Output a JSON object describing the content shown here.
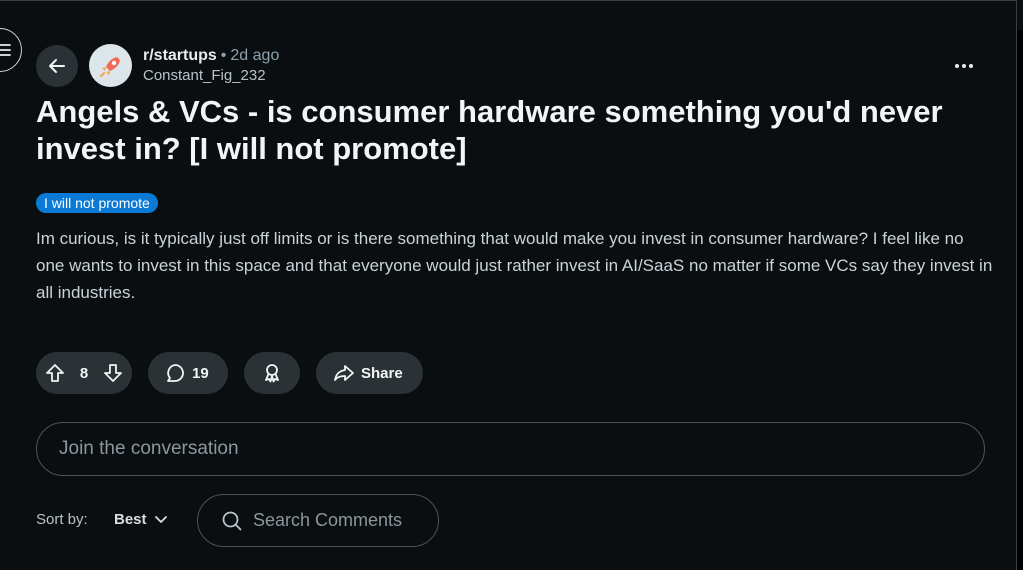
{
  "post": {
    "subreddit": "r/startups",
    "separator": "•",
    "time": "2d ago",
    "author": "Constant_Fig_232",
    "title": "Angels & VCs - is consumer hardware something you'd never invest in? [I will not promote]",
    "flair": "I will not promote",
    "body": "Im curious, is it typically just off limits or is there something that would make you invest in consumer hardware? I feel like no one wants to invest in this space and that everyone would just rather invest in AI/SaaS no matter if some VCs say they invest in all industries."
  },
  "actions": {
    "votes": "8",
    "comments": "19",
    "share_label": "Share"
  },
  "comment_box": {
    "placeholder": "Join the conversation"
  },
  "sort": {
    "label": "Sort by:",
    "value": "Best"
  },
  "search": {
    "placeholder": "Search Comments"
  },
  "icons": {
    "menu": "hamburger-icon",
    "back": "back-arrow-icon",
    "more": "more-horizontal-icon",
    "upvote": "upvote-icon",
    "downvote": "downvote-icon",
    "comment": "comment-icon",
    "award": "award-icon",
    "share": "share-icon",
    "chevron": "chevron-down-icon",
    "search": "search-icon"
  },
  "colors": {
    "background": "#0b0e10",
    "button_bg": "#2a3236",
    "flair_bg": "#0a7ad6"
  }
}
